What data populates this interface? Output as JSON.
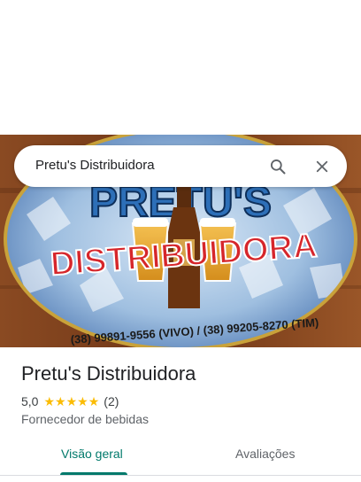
{
  "search": {
    "query": "Pretu's Distribuidora",
    "search_icon": "search-icon",
    "close_icon": "close-icon"
  },
  "hero": {
    "image_subject": "distributor banner with beer bottle and glasses",
    "banner_text_top": "PRETU'S",
    "banner_text_main": "DISTRIBUIDORA",
    "banner_phones": "(38) 99891-9556 (VIVO) / (38) 99205-8270 (TIM)"
  },
  "place": {
    "name": "Pretu's Distribuidora",
    "rating": "5,0",
    "stars": 5,
    "review_count": "(2)",
    "category": "Fornecedor de bebidas"
  },
  "tabs": [
    {
      "label": "Visão geral",
      "active": true
    },
    {
      "label": "Avaliações",
      "active": false
    }
  ],
  "colors": {
    "accent": "#00796b",
    "star": "#fbbc04"
  }
}
